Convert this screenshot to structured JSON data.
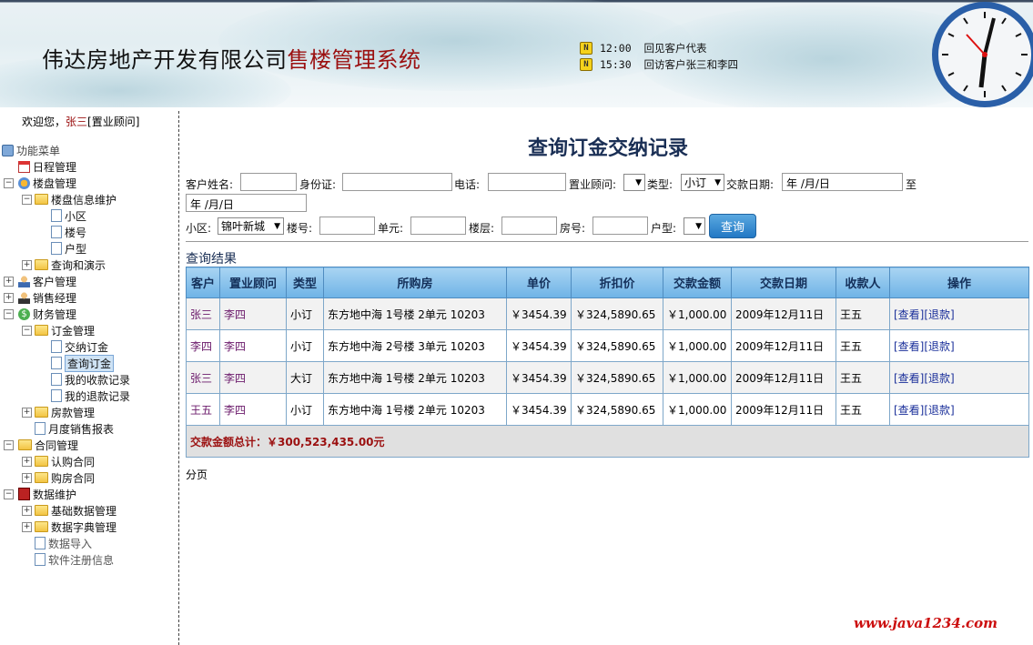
{
  "header": {
    "title_company": "伟达房地产开发有限公司",
    "title_system": "售楼管理系统",
    "notes": [
      {
        "time": "12:00",
        "text": "回见客户代表"
      },
      {
        "time": "15:30",
        "text": "回访客户张三和李四"
      }
    ]
  },
  "user": {
    "prefix": "欢迎您，",
    "name": "张三",
    "role": "[置业顾问]"
  },
  "menu": {
    "root": "功能菜单",
    "items": {
      "schedule": "日程管理",
      "property": "楼盘管理",
      "property_info": "楼盘信息维护",
      "district": "小区",
      "building": "楼号",
      "unit_type": "户型",
      "query_demo": "查询和演示",
      "customer": "客户管理",
      "sales_manager": "销售经理",
      "finance": "财务管理",
      "deposit": "订金管理",
      "pay_deposit": "交纳订金",
      "query_deposit": "查询订金",
      "my_receipts": "我的收款记录",
      "my_refunds": "我的退款记录",
      "payment": "房款管理",
      "monthly_report": "月度销售报表",
      "contract": "合同管理",
      "subscription": "认购合同",
      "purchase": "购房合同",
      "data": "数据维护",
      "base_data": "基础数据管理",
      "dict": "数据字典管理",
      "import": "数据导入",
      "register": "软件注册信息"
    }
  },
  "page": {
    "heading": "查询订金交纳记录"
  },
  "form": {
    "customer_name_label": "客户姓名:",
    "id_label": "身份证:",
    "phone_label": "电话:",
    "consultant_label": "置业顾问:",
    "type_label": "类型:",
    "type_value": "小订",
    "date_label": "交款日期:",
    "date_from": "年 /月/日",
    "to_label": "至",
    "date_to": "年 /月/日",
    "district_label": "小区:",
    "district_value": "锦叶新城",
    "building_label": "楼号:",
    "unit_label": "单元:",
    "floor_label": "楼层:",
    "room_label": "房号:",
    "unit_type_label": "户型:",
    "search_label": "查询"
  },
  "results": {
    "title": "查询结果",
    "columns": [
      "客户",
      "置业顾问",
      "类型",
      "所购房",
      "单价",
      "折扣价",
      "交款金额",
      "交款日期",
      "收款人",
      "操作"
    ],
    "rows": [
      {
        "customer": "张三",
        "consultant": "李四",
        "type": "小订",
        "house": "东方地中海 1号楼 2单元 10203",
        "price": "￥3454.39",
        "discount": "￥324,5890.65",
        "amount": "￥1,000.00",
        "date": "2009年12月11日",
        "payee": "王五",
        "view": "[查看]",
        "refund": "[退款]"
      },
      {
        "customer": "李四",
        "consultant": "李四",
        "type": "小订",
        "house": "东方地中海 2号楼 3单元 10203",
        "price": "￥3454.39",
        "discount": "￥324,5890.65",
        "amount": "￥1,000.00",
        "date": "2009年12月11日",
        "payee": "王五",
        "view": "[查看]",
        "refund": "[退款]"
      },
      {
        "customer": "张三",
        "consultant": "李四",
        "type": "大订",
        "house": "东方地中海 1号楼 2单元 10203",
        "price": "￥3454.39",
        "discount": "￥324,5890.65",
        "amount": "￥1,000.00",
        "date": "2009年12月11日",
        "payee": "王五",
        "view": "[查看]",
        "refund": "[退款]"
      },
      {
        "customer": "王五",
        "consultant": "李四",
        "type": "小订",
        "house": "东方地中海 1号楼 2单元 10203",
        "price": "￥3454.39",
        "discount": "￥324,5890.65",
        "amount": "￥1,000.00",
        "date": "2009年12月11日",
        "payee": "王五",
        "view": "[查看]",
        "refund": "[退款]"
      }
    ],
    "total": "交款金额总计：￥300,523,435.00元"
  },
  "pager": "分页",
  "footer": "www.java1234.com",
  "colors": {
    "accent_red": "#9b1010",
    "heading_blue": "#1a2f55",
    "header_bg": "#e3eef2",
    "table_head": "#6eb3e6"
  }
}
